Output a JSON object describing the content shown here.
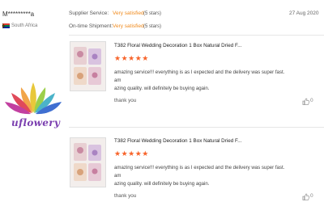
{
  "reviewer": {
    "name": "M*********a",
    "country": "South Africa"
  },
  "summary": {
    "supplier_service_label": "Supplier Service:",
    "supplier_service_value": "Very satisfied",
    "supplier_service_count": "(5 stars)",
    "shipment_label": "On-time Shipment:",
    "shipment_value": "Very satisfied",
    "shipment_count": "(5 stars)",
    "date": "27 Aug 2020"
  },
  "logo": {
    "text": "uflowery"
  },
  "reviews": [
    {
      "product_title": "T382 Floral Wedding Decoration 1 Box Natural Dried F...",
      "stars": "★★★★★",
      "rating": 5,
      "text_line1": "amazing service!!! everything is as I expected and the delivery was super fast. am",
      "text_line2": "azing quality. will definitely be buying again.",
      "reply": "thank you",
      "likes": "0"
    },
    {
      "product_title": "T382 Floral Wedding Decoration 1 Box Natural Dried F...",
      "stars": "★★★★★",
      "rating": 5,
      "text_line1": "amazing service!!! everything is as I expected and the delivery was super fast. am",
      "text_line2": "azing quality. will definitely be buying again.",
      "reply": "thank you",
      "likes": "0"
    }
  ],
  "colors": {
    "accent": "#f08a1c",
    "star": "#f7642b",
    "logo_text": "#7b3fb0"
  },
  "icons": {
    "like": "thumbs-up-icon",
    "flag": "south-africa-flag-icon"
  }
}
